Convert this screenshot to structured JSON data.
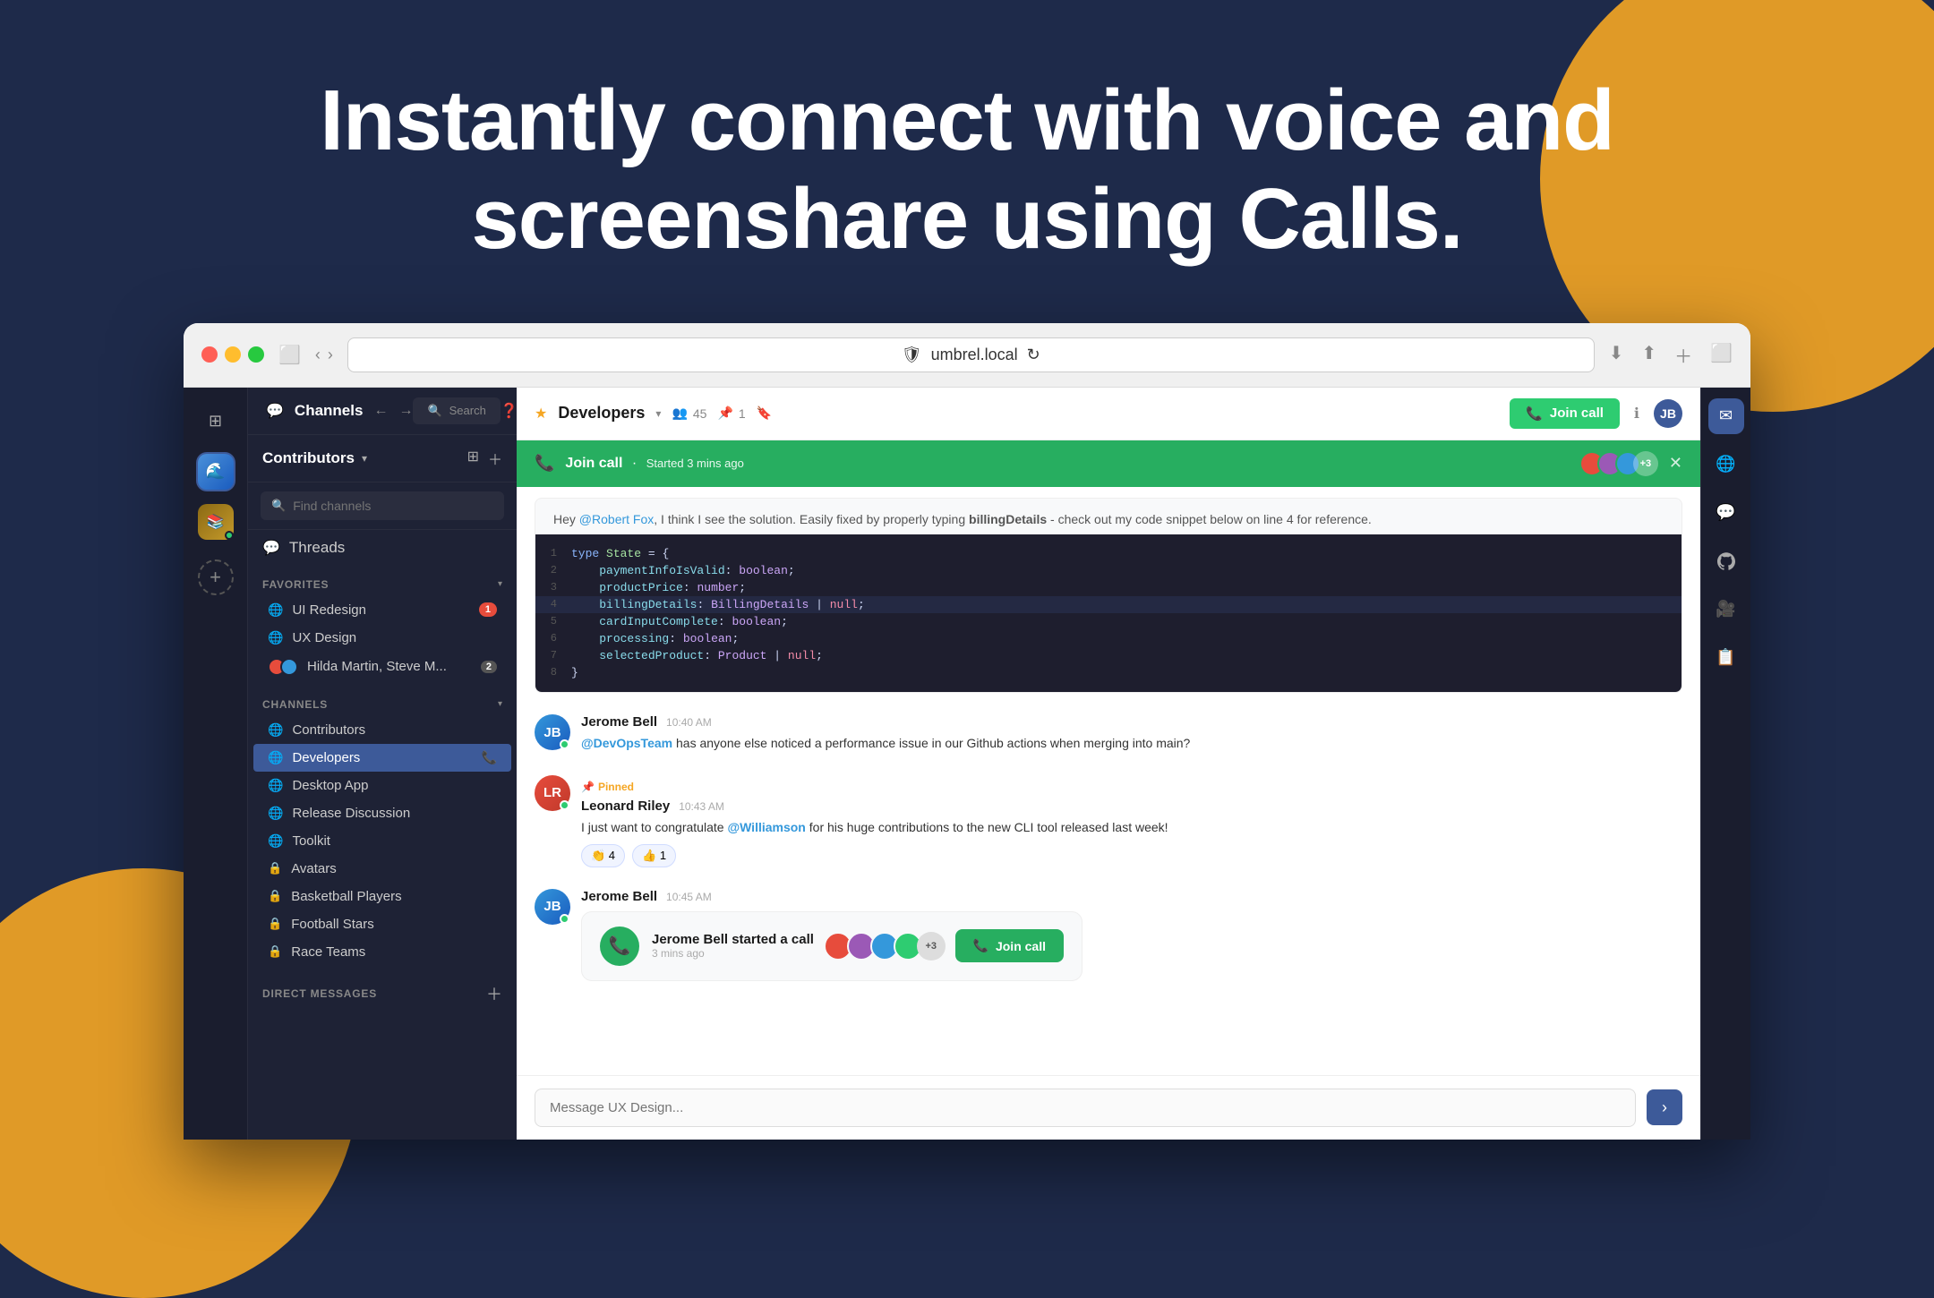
{
  "hero": {
    "title": "Instantly connect with voice and screenshare using Calls."
  },
  "browser": {
    "url": "umbrel.local"
  },
  "topbar": {
    "channels_label": "Channels",
    "search_placeholder": "Search"
  },
  "workspace": {
    "name": "Contributors",
    "chevron": "▾"
  },
  "search": {
    "placeholder": "Find channels"
  },
  "threads": {
    "label": "Threads"
  },
  "sections": {
    "favorites_label": "FAVORITES",
    "channels_label": "CHANNELS",
    "dm_label": "DIRECT MESSAGES"
  },
  "favorites": [
    {
      "name": "UI Redesign",
      "badge": "1"
    },
    {
      "name": "UX Design",
      "badge": ""
    },
    {
      "name": "Hilda Martin, Steve M...",
      "badge": "2"
    }
  ],
  "channels": [
    {
      "name": "Contributors",
      "type": "globe",
      "active": false
    },
    {
      "name": "Developers",
      "type": "globe",
      "active": true,
      "call": true
    },
    {
      "name": "Desktop App",
      "type": "globe",
      "active": false
    },
    {
      "name": "Release Discussion",
      "type": "globe",
      "active": false
    },
    {
      "name": "Toolkit",
      "type": "globe",
      "active": false
    },
    {
      "name": "Avatars",
      "type": "lock",
      "active": false
    },
    {
      "name": "Basketball Players",
      "type": "lock",
      "active": false
    },
    {
      "name": "Football Stars",
      "type": "lock",
      "active": false
    },
    {
      "name": "Race Teams",
      "type": "lock",
      "active": false
    }
  ],
  "channel_header": {
    "name": "Developers",
    "members": "45",
    "pins": "1",
    "join_call_label": "Join call"
  },
  "call_banner": {
    "title": "Join call",
    "subtitle": "Started 3 mins ago",
    "plus_count": "+3"
  },
  "messages": [
    {
      "author": "Jerome Bell",
      "time": "10:40 AM",
      "avatar_initials": "JB",
      "text_prefix": "",
      "mention": "@DevOpsTeam",
      "text_suffix": " has anyone else noticed a performance issue in our Github actions when merging into main?",
      "pinned": false,
      "reactions": []
    },
    {
      "author": "Leonard Riley",
      "time": "10:43 AM",
      "avatar_initials": "LR",
      "text_prefix": "I just want to congratulate ",
      "mention": "@Williamson",
      "text_suffix": " for his huge contributions to the new CLI tool released last week!",
      "pinned": true,
      "reactions": [
        {
          "emoji": "👏",
          "count": "4"
        },
        {
          "emoji": "👍",
          "count": "1"
        }
      ]
    },
    {
      "author": "Jerome Bell",
      "time": "10:45 AM",
      "avatar_initials": "JB",
      "call_card": true,
      "call_title": "Jerome Bell started a call",
      "call_time": "3 mins ago",
      "join_label": "Join call",
      "plus_count": "+3"
    }
  ],
  "code": {
    "intro_text": "Hey @Robert Fox, I think I see the solution. Easily fixed by properly typing billingDetails - check out my code snippet below on line 4 for reference.",
    "lines": [
      {
        "num": "1",
        "content": "type State = {"
      },
      {
        "num": "2",
        "content": "  paymentInfoIsValid: boolean;"
      },
      {
        "num": "3",
        "content": "  productPrice: number;"
      },
      {
        "num": "4",
        "content": "  billingDetails: BillingDetails | null;"
      },
      {
        "num": "5",
        "content": "  cardInputComplete: boolean;"
      },
      {
        "num": "6",
        "content": "  processing: boolean;"
      },
      {
        "num": "7",
        "content": "  selectedProduct: Product | null;"
      },
      {
        "num": "8",
        "content": "}"
      }
    ]
  },
  "message_input": {
    "placeholder": "Message UX Design..."
  },
  "right_sidebar_icons": [
    "✉",
    "🌐",
    "💬",
    "🐙",
    "🎥",
    "📋"
  ]
}
